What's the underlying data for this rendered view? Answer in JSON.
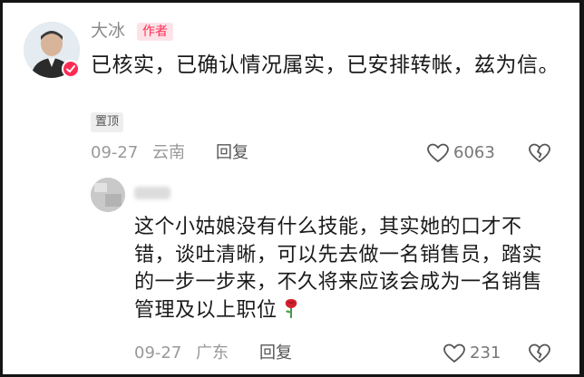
{
  "top_comment": {
    "author": "大冰",
    "author_badge": "作者",
    "text": "已核实，已确认情况属实，已安排转帐，兹为信。",
    "pinned_label": "置顶",
    "date": "09-27",
    "location": "云南",
    "reply_label": "回复",
    "like_count": "6063"
  },
  "reply_comment": {
    "author": "",
    "text": "这个小姑娘没有什么技能，其实她的口才不错，谈吐清晰，可以先去做一名销售员，踏实的一步一步来，不久将来应该会成为一名销售管理及以上职位",
    "emoji": "rose",
    "date": "09-27",
    "location": "广东",
    "reply_label": "回复",
    "like_count": "231"
  },
  "colors": {
    "accent": "#fe2c55",
    "text_primary": "#1a1a1a",
    "text_secondary": "#999999"
  },
  "icons": [
    "verified-check-icon",
    "heart-icon",
    "broken-heart-icon",
    "rose-icon"
  ]
}
